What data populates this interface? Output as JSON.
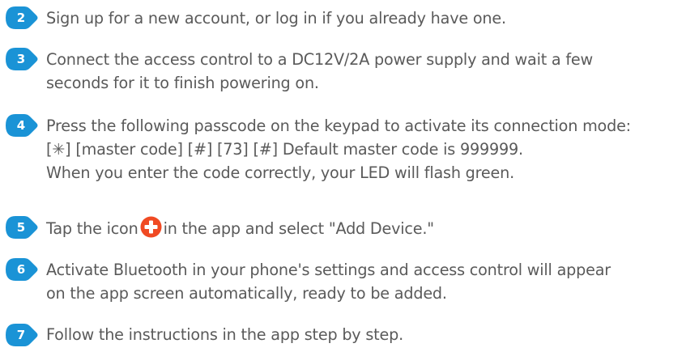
{
  "colors": {
    "badge": "#1a93d6",
    "text": "#5a5a5a",
    "plus_icon": "#f04a23"
  },
  "steps": [
    {
      "number": "2",
      "lines": [
        "Sign up for a new account, or log in if you already have one."
      ]
    },
    {
      "number": "3",
      "lines": [
        "Connect the access control to a DC12V/2A power supply and wait a few",
        "seconds for it to finish powering on."
      ]
    },
    {
      "number": "4",
      "lines": [
        "Press the following passcode on the keypad to activate its connection mode:",
        "[✳] [master code] [#] [73] [#] Default master code is 999999.",
        "When you enter the code correctly, your LED will flash green."
      ]
    },
    {
      "number": "5",
      "text_before_icon": "Tap the icon",
      "icon": "plus-circle-icon",
      "text_after_icon": "in the app and select \"Add Device.\""
    },
    {
      "number": "6",
      "lines": [
        "Activate Bluetooth in your phone's settings and access control will appear",
        "on the app screen automatically, ready to be added."
      ]
    },
    {
      "number": "7",
      "lines": [
        "Follow the instructions in the app step by step."
      ]
    }
  ]
}
